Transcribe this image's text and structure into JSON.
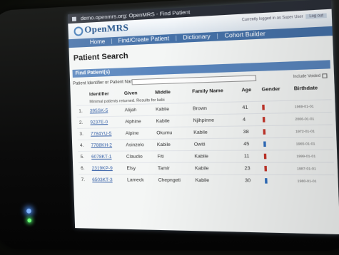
{
  "browser": {
    "title": "demo.openmrs.org: OpenMRS - Find Patient"
  },
  "brand": {
    "logo": "OpenMRS",
    "user_info": "Currently logged in as Super User",
    "badge": "Log out"
  },
  "nav": {
    "items": [
      "Home",
      "Find/Create Patient",
      "Dictionary",
      "Cohort Builder"
    ]
  },
  "page": {
    "title": "Patient Search"
  },
  "find_panel": {
    "header": "Find Patient(s)",
    "search_label": "Patient Identifier or Patient Name:",
    "search_value": "",
    "include_voided_label": "Include Voided"
  },
  "table": {
    "columns": [
      "Identifier",
      "Given",
      "Middle",
      "Family Name",
      "Age",
      "Gender",
      "Birthdate"
    ],
    "note": "Minimal patients returned. Results for kabi",
    "rows": [
      {
        "num": "1.",
        "identifier": "395SK-5",
        "given": "Alijah",
        "middle": "Kabile",
        "family": "Brown",
        "age": "41",
        "gender": "f",
        "birthdate": "1969-01-01"
      },
      {
        "num": "2.",
        "identifier": "9237E-0",
        "given": "Alphine",
        "middle": "Kabile",
        "family": "Njihpinne",
        "age": "4",
        "gender": "f",
        "birthdate": "2006-01-01"
      },
      {
        "num": "3.",
        "identifier": "7784YU-5",
        "given": "Alpine",
        "middle": "Okumu",
        "family": "Kabile",
        "age": "38",
        "gender": "f",
        "birthdate": "1972-01-01"
      },
      {
        "num": "4.",
        "identifier": "7788KH-2",
        "given": "Asinzelo",
        "middle": "Kabile",
        "family": "Owiti",
        "age": "45",
        "gender": "m",
        "birthdate": "1965-01-01"
      },
      {
        "num": "5.",
        "identifier": "6078KT-1",
        "given": "Claudio",
        "middle": "Fiti",
        "family": "Kabile",
        "age": "11",
        "gender": "f",
        "birthdate": "1999-01-01"
      },
      {
        "num": "6.",
        "identifier": "2319KP-9",
        "given": "Elsy",
        "middle": "Tamir",
        "family": "Kabile",
        "age": "23",
        "gender": "f",
        "birthdate": "1987-01-01"
      },
      {
        "num": "7.",
        "identifier": "6503KT-3",
        "given": "Lameck",
        "middle": "Chepngeti",
        "family": "Kabile",
        "age": "30",
        "gender": "m",
        "birthdate": "1980-01-01"
      }
    ]
  },
  "colors": {
    "nav": "#4571a8",
    "header": "#5a86be",
    "female": "#c6362b",
    "male": "#2f6fbf"
  }
}
